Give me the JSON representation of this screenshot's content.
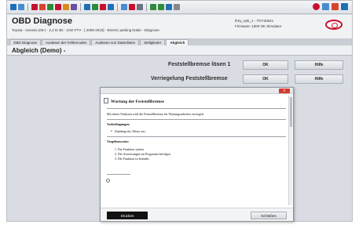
{
  "header": {
    "app_title": "OBD Diagnose",
    "vehicle": "Toyota - Avensis (09-) - 2,2 D-4D - 2AD-FTV - [ 2009-2010] - Electric parking brake - Diagnose",
    "user_line": "thny_epb_1 - TOY20641",
    "firmware_line": "Firmware: 1000  OK  Simulator"
  },
  "tabs": [
    {
      "label": "OBD Diagnose"
    },
    {
      "label": "Auslesen der Fehlercodes"
    },
    {
      "label": "Auslesen von Datenlisten"
    },
    {
      "label": "Stellglieder"
    },
    {
      "label": "Abgleich"
    }
  ],
  "section": {
    "title": "Abgleich (Demo) -"
  },
  "functions": [
    {
      "label": "Feststellbremse lösen 1",
      "ok_label": "OK",
      "help_label": "Hilfe"
    },
    {
      "label": "Verriegelung Feststellbremse",
      "ok_label": "OK",
      "help_label": "Hilfe"
    }
  ],
  "dialog": {
    "close_label": "x",
    "heading": "Wartung der Feststellbremse",
    "intro": "Mit dieser Funktion wird die Feststellbremse für Wartungsarbeiten verriegelt.",
    "preconditions_title": "Vorbedingungen:",
    "precondition_1": "Zündung ein, Motor aus.",
    "procedure_title": "Vorgehensweise:",
    "steps": [
      "1.  Die Funktion starten.",
      "2.  Die Anweisungen im Programm befolgen.",
      "3.  Die Funktion ist beendet."
    ],
    "print_label": "Drucken",
    "close_button_label": "Schließen"
  },
  "colors": {
    "accent_red": "#c8102e",
    "toolbar_icons": [
      "#1f6fb8",
      "#c8102e",
      "#2e8b3a",
      "#d98c1e",
      "#6b4fa3",
      "#1f6fb8",
      "#888888"
    ]
  }
}
